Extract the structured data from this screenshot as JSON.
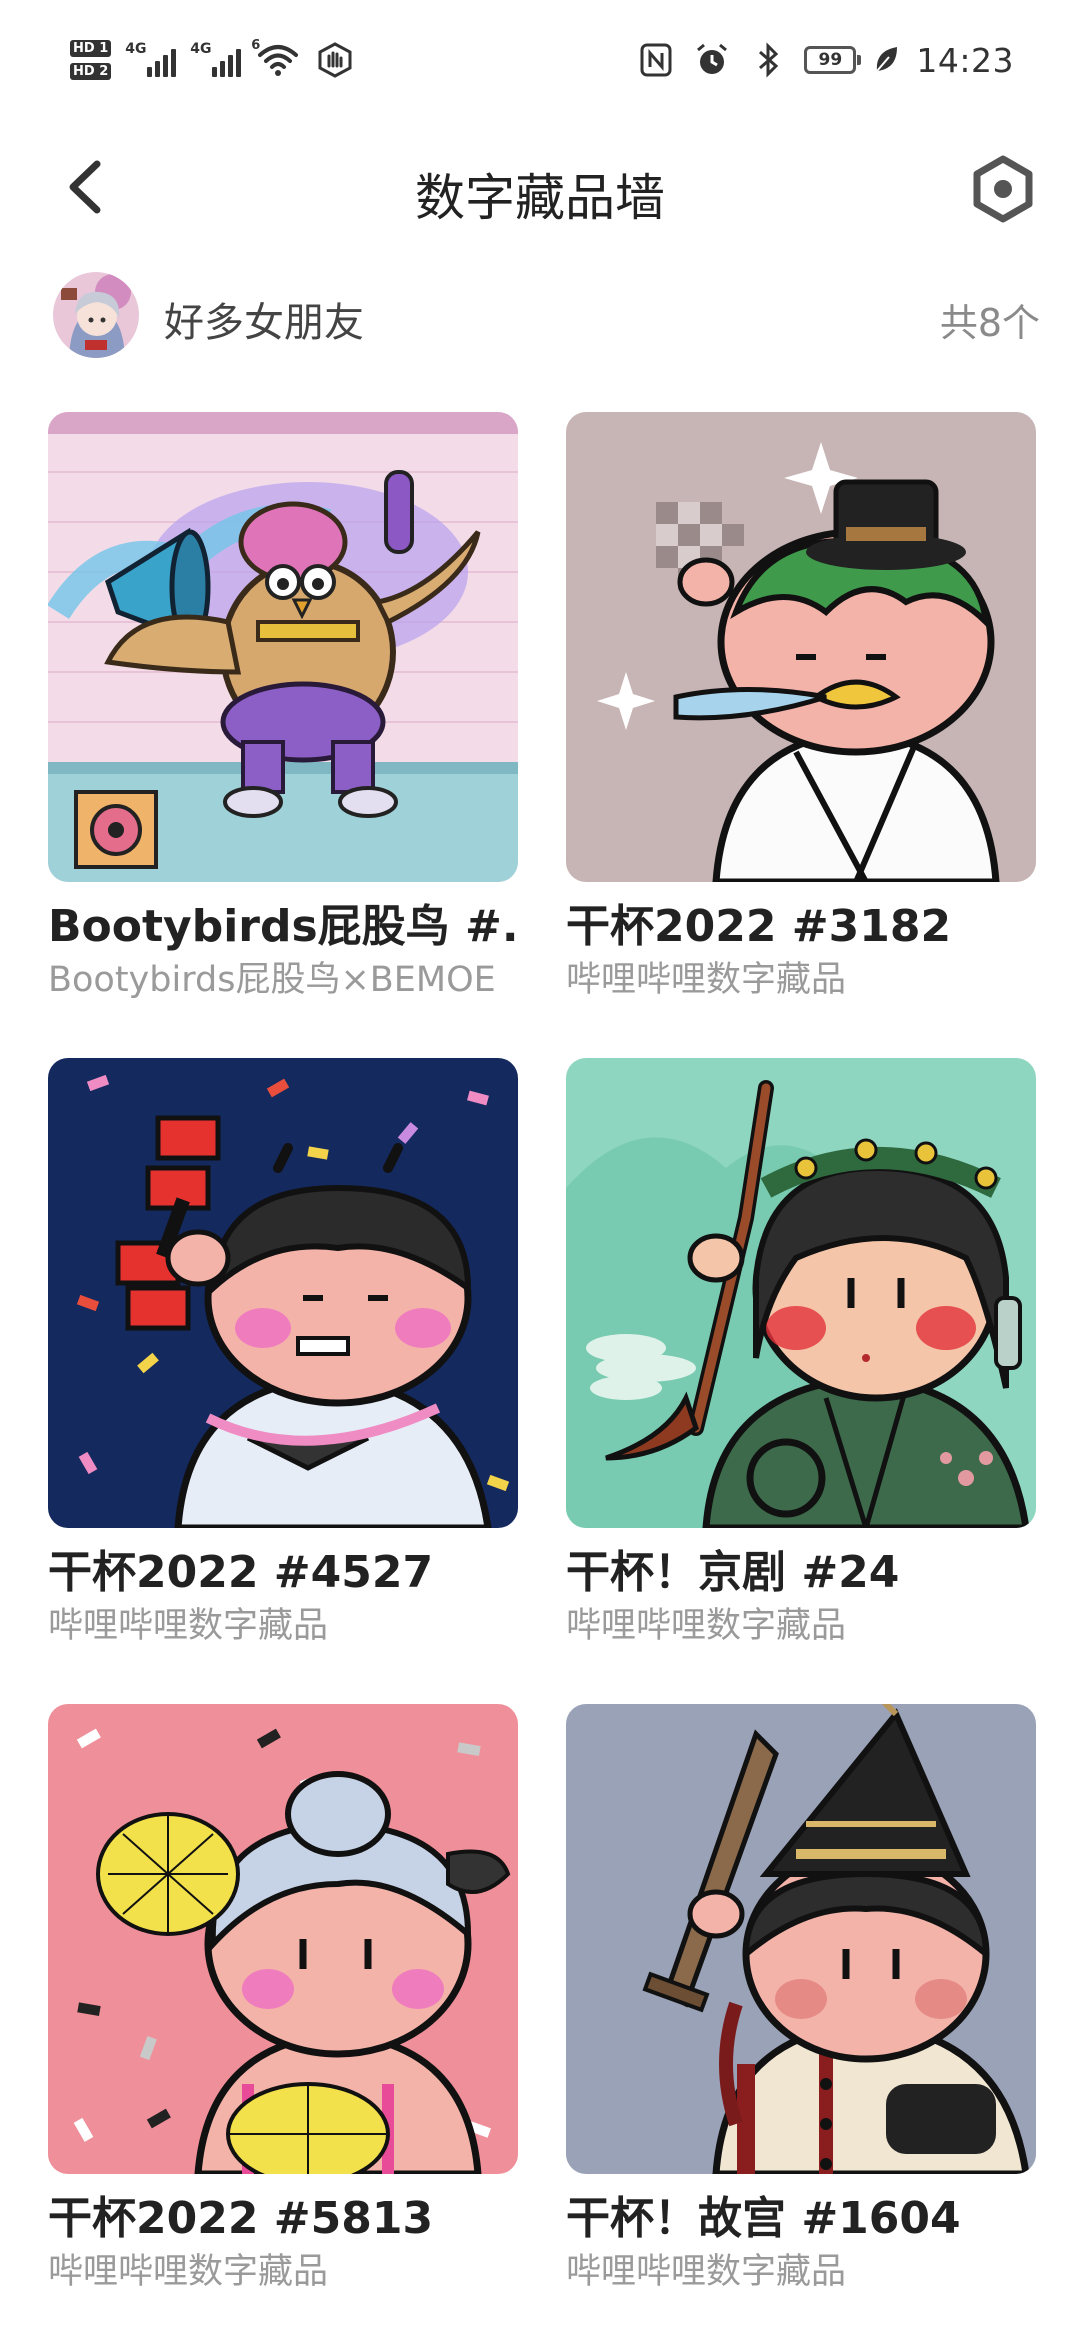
{
  "status_bar": {
    "hd1": "HD 1",
    "hd2": "HD 2",
    "network1": "4G",
    "network2": "4G",
    "wifi_badge": "6",
    "battery": "99",
    "time": "14:23",
    "icons": [
      "nfc-icon",
      "alarm-icon",
      "bluetooth-icon",
      "leaf-icon"
    ]
  },
  "header": {
    "title": "数字藏品墙"
  },
  "owner": {
    "name": "好多女朋友",
    "count": "共8个"
  },
  "items": [
    {
      "title": "Bootybirds屁股鸟 #...",
      "subtitle": "Bootybirds屁股鸟×BEMOE",
      "bg": "#f3dce8"
    },
    {
      "title": "干杯2022 #3182",
      "subtitle": "哔哩哔哩数字藏品",
      "bg": "#c7b4b4"
    },
    {
      "title": "干杯2022 #4527",
      "subtitle": "哔哩哔哩数字藏品",
      "bg": "#14295e"
    },
    {
      "title": "干杯！京剧 #24",
      "subtitle": "哔哩哔哩数字藏品",
      "bg": "#8ed6c0"
    },
    {
      "title": "干杯2022 #5813",
      "subtitle": "哔哩哔哩数字藏品",
      "bg": "#ef8f99"
    },
    {
      "title": "干杯！故宫 #1604",
      "subtitle": "哔哩哔哩数字藏品",
      "bg": "#9aa2b8"
    }
  ]
}
